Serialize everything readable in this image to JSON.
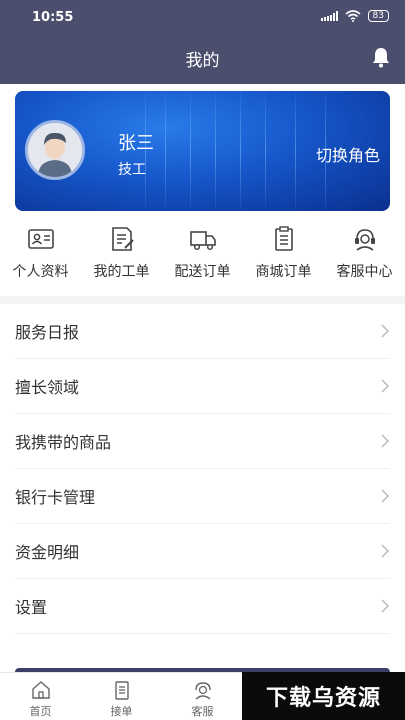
{
  "status": {
    "time": "10:55",
    "battery": "83"
  },
  "header": {
    "title": "我的"
  },
  "profile": {
    "name": "张三",
    "role": "技工",
    "switch_label": "切换角色"
  },
  "quick_actions": [
    {
      "label": "个人资料",
      "icon": "id-card-icon"
    },
    {
      "label": "我的工单",
      "icon": "work-order-icon"
    },
    {
      "label": "配送订单",
      "icon": "truck-icon"
    },
    {
      "label": "商城订单",
      "icon": "clipboard-icon"
    },
    {
      "label": "客服中心",
      "icon": "headset-icon"
    }
  ],
  "menu": [
    {
      "label": "服务日报"
    },
    {
      "label": "擅长领域"
    },
    {
      "label": "我携带的商品"
    },
    {
      "label": "银行卡管理"
    },
    {
      "label": "资金明细"
    },
    {
      "label": "设置"
    }
  ],
  "tabbar": [
    {
      "label": "首页",
      "icon": "home-icon"
    },
    {
      "label": "接单",
      "icon": "order-icon"
    },
    {
      "label": "客服",
      "icon": "service-icon"
    }
  ],
  "watermark": {
    "text": "下载乌资源"
  }
}
